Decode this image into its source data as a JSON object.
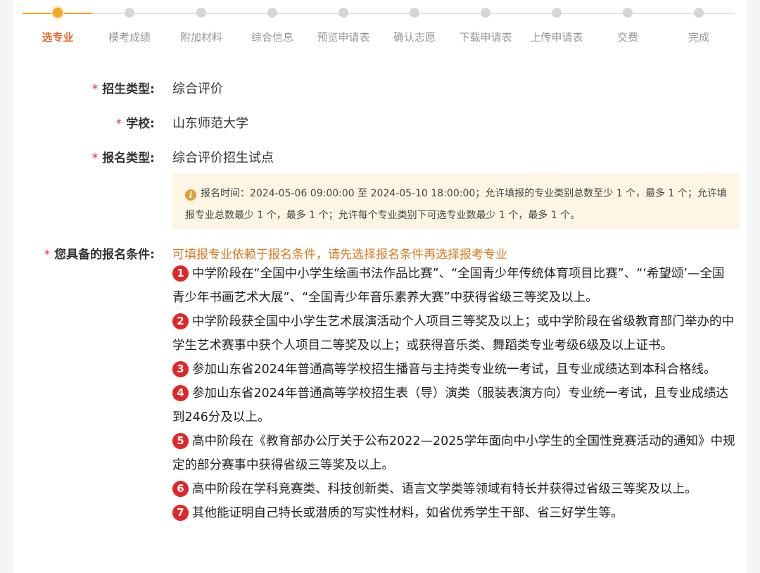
{
  "steps": [
    {
      "label": "选专业",
      "active": true
    },
    {
      "label": "模考成绩"
    },
    {
      "label": "附加材料"
    },
    {
      "label": "综合信息"
    },
    {
      "label": "预览申请表"
    },
    {
      "label": "确认志愿"
    },
    {
      "label": "下载申请表"
    },
    {
      "label": "上传申请表"
    },
    {
      "label": "交费"
    },
    {
      "label": "完成"
    }
  ],
  "form": {
    "required_mark": "*",
    "admission_type": {
      "label": "招生类型:",
      "value": "综合评价"
    },
    "school": {
      "label": "学校:",
      "value": "山东师范大学"
    },
    "registration_type": {
      "label": "报名类型:",
      "value": "综合评价招生试点"
    },
    "notice": {
      "icon": "info-icon",
      "text": "报名时间：2024-05-06 09:00:00 至 2024-05-10 18:00:00；允许填报的专业类别总数至少 1 个，最多 1 个；允许填报专业总数最少 1 个，最多 1 个；允许每个专业类别下可选专业数最少 1 个，最多 1 个。"
    },
    "conditions_label": "您具备的报名条件:",
    "conditions_hint": "可填报专业依赖于报名条件，请先选择报名条件再选择报考专业",
    "conditions": [
      {
        "num": "1",
        "text": "中学阶段在“全国中小学生绘画书法作品比赛”、“全国青少年传统体育项目比赛”、“‘希望颂’—全国青少年书画艺术大展”、“全国青少年音乐素养大赛”中获得省级三等奖及以上。"
      },
      {
        "num": "2",
        "text": "中学阶段获全国中小学生艺术展演活动个人项目三等奖及以上；或中学阶段在省级教育部门举办的中学生艺术赛事中获个人项目二等奖及以上；或获得音乐类、舞蹈类专业考级6级及以上证书。"
      },
      {
        "num": "3",
        "text": "参加山东省2024年普通高等学校招生播音与主持类专业统一考试，且专业成绩达到本科合格线。"
      },
      {
        "num": "4",
        "text": "参加山东省2024年普通高等学校招生表（导）演类（服装表演方向）专业统一考试，且专业成绩达到246分及以上。"
      },
      {
        "num": "5",
        "text": "高中阶段在《教育部办公厅关于公布2022—2025学年面向中小学生的全国性竞赛活动的通知》中规定的部分赛事中获得省级三等奖及以上。"
      },
      {
        "num": "6",
        "text": "高中阶段在学科竞赛类、科技创新类、语言文学类等领域有特长并获得过省级三等奖及以上。"
      },
      {
        "num": "7",
        "text": "其他能证明自己特长或潜质的写实性材料，如省优秀学生干部、省三好学生等。"
      }
    ]
  },
  "colors": {
    "accent": "#f5a623",
    "active_step_text": "#e8692b",
    "required": "#e2312b",
    "hint": "#d9781f",
    "notice_bg": "#fdf6e4",
    "badge": "#e0262b"
  }
}
